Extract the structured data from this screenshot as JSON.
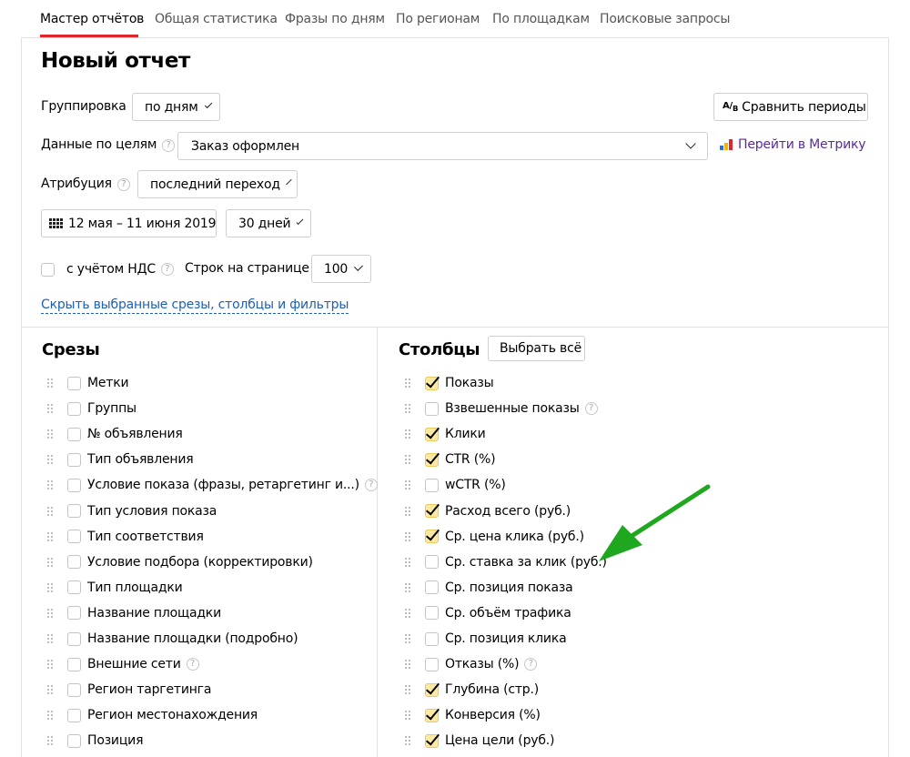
{
  "tabs": [
    {
      "label": "Мастер отчётов",
      "active": true
    },
    {
      "label": "Общая статистика"
    },
    {
      "label": "Фразы по дням"
    },
    {
      "label": "По регионам"
    },
    {
      "label": "По площадкам"
    },
    {
      "label": "Поисковые запросы"
    }
  ],
  "report": {
    "title": "Новый отчет",
    "grouping_label": "Группировка",
    "grouping_value": "по дням",
    "compare_button": "Сравнить периоды",
    "goals_label": "Данные по целям",
    "goals_value": "Заказ оформлен",
    "metrika_link": "Перейти в Метрику",
    "attribution_label": "Атрибуция",
    "attribution_value": "последний переход",
    "date_range": "12 мая – 11 июня 2019",
    "period_value": "30 дней",
    "vat_label": "с учётом НДС",
    "rows_label": "Строк на странице",
    "rows_value": "100",
    "hide_link": "Скрыть выбранные срезы, столбцы и фильтры"
  },
  "slices": {
    "title": "Срезы",
    "items": [
      {
        "label": "Метки",
        "checked": false
      },
      {
        "label": "Группы",
        "checked": false
      },
      {
        "label": "№ объявления",
        "checked": false
      },
      {
        "label": "Тип объявления",
        "checked": false
      },
      {
        "label": "Условие показа (фразы, ретаргетинг и...)",
        "checked": false,
        "help": true
      },
      {
        "label": "Тип условия показа",
        "checked": false
      },
      {
        "label": "Тип соответствия",
        "checked": false
      },
      {
        "label": "Условие подбора (корректировки)",
        "checked": false
      },
      {
        "label": "Тип площадки",
        "checked": false
      },
      {
        "label": "Название площадки",
        "checked": false
      },
      {
        "label": "Название площадки (подробно)",
        "checked": false
      },
      {
        "label": "Внешние сети",
        "checked": false,
        "help": true
      },
      {
        "label": "Регион таргетинга",
        "checked": false
      },
      {
        "label": "Регион местонахождения",
        "checked": false
      },
      {
        "label": "Позиция",
        "checked": false
      }
    ]
  },
  "columns": {
    "title": "Столбцы",
    "select_all": "Выбрать всё",
    "items": [
      {
        "label": "Показы",
        "checked": true
      },
      {
        "label": "Взвешенные показы",
        "checked": false,
        "help": true
      },
      {
        "label": "Клики",
        "checked": true
      },
      {
        "label": "CTR (%)",
        "checked": true
      },
      {
        "label": "wCTR (%)",
        "checked": false
      },
      {
        "label": "Расход всего (руб.)",
        "checked": true
      },
      {
        "label": "Ср. цена клика (руб.)",
        "checked": true
      },
      {
        "label": "Ср. ставка за клик (руб.)",
        "checked": false
      },
      {
        "label": "Ср. позиция показа",
        "checked": false
      },
      {
        "label": "Ср. объём трафика",
        "checked": false
      },
      {
        "label": "Ср. позиция клика",
        "checked": false
      },
      {
        "label": "Отказы (%)",
        "checked": false,
        "help": true
      },
      {
        "label": "Глубина (стр.)",
        "checked": true
      },
      {
        "label": "Конверсия (%)",
        "checked": true
      },
      {
        "label": "Цена цели (руб.)",
        "checked": true
      }
    ]
  },
  "colors": {
    "accent_red": "#e0252b",
    "link_purple": "#5a2b97",
    "link_blue": "#1d5fb5",
    "checkbox_checked": "#fde9a3",
    "arrow_green": "#1fa81f"
  }
}
